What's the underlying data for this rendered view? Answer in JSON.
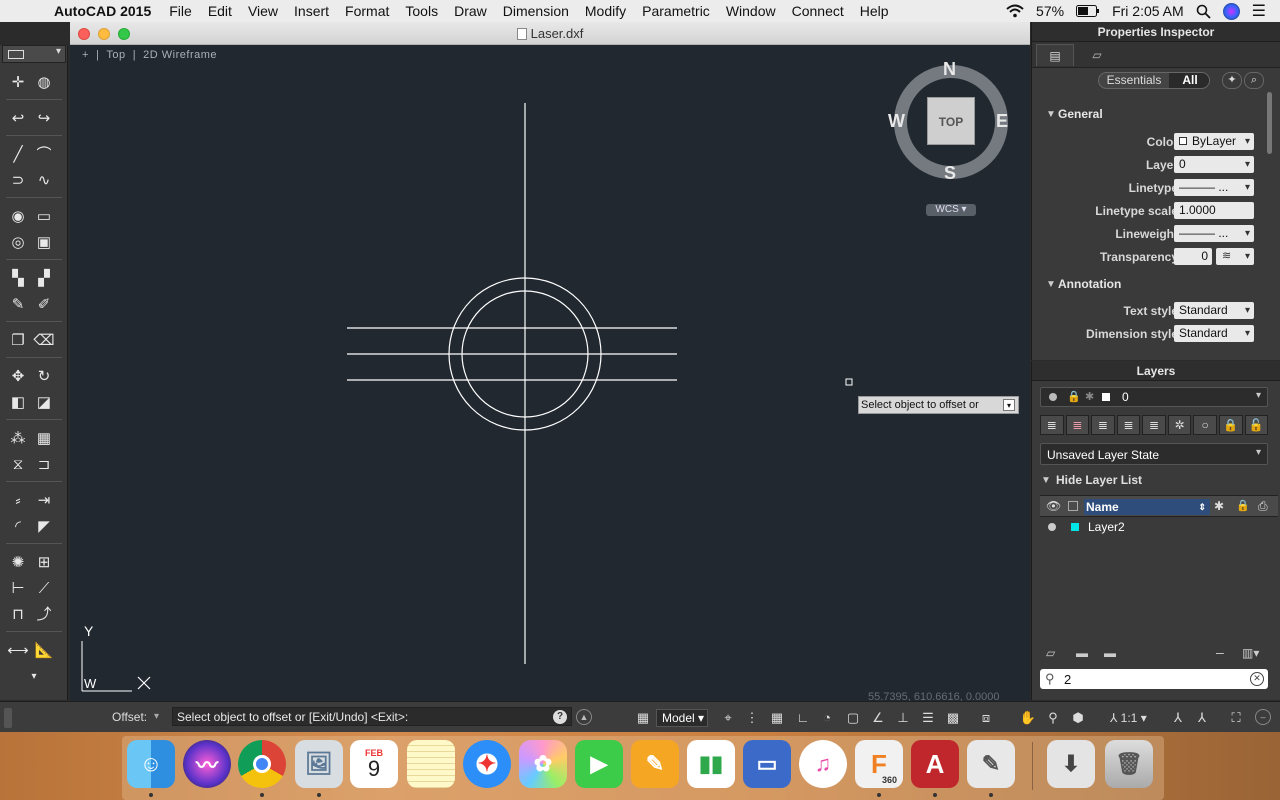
{
  "menubar": {
    "app_name": "AutoCAD 2015",
    "items": [
      "File",
      "Edit",
      "View",
      "Insert",
      "Format",
      "Tools",
      "Draw",
      "Dimension",
      "Modify",
      "Parametric",
      "Window",
      "Connect",
      "Help"
    ],
    "battery": "57%",
    "clock": "Fri 2:05 AM"
  },
  "window": {
    "title": "Laser.dxf"
  },
  "viewport": {
    "label_plus": "+",
    "view": "Top",
    "visual_style": "2D Wireframe"
  },
  "viewcube": {
    "north": "N",
    "south": "S",
    "east": "E",
    "west": "W",
    "face": "TOP",
    "ucs": "WCS"
  },
  "ucs_icon": {
    "y_label": "Y",
    "w_label": "W"
  },
  "tooltip": {
    "text": "Select object to offset or"
  },
  "coordinates": "55.7395, 610.6616, 0.0000",
  "properties": {
    "title": "Properties Inspector",
    "tabs": {
      "essentials": "Essentials",
      "all": "All"
    },
    "general_section": "General",
    "annotation_section": "Annotation",
    "rows": [
      {
        "label": "Color",
        "value": "ByLayer"
      },
      {
        "label": "Layer",
        "value": "0"
      },
      {
        "label": "Linetype",
        "value": "——— ..."
      },
      {
        "label": "Linetype scale",
        "value": "1.0000"
      },
      {
        "label": "Lineweight",
        "value": "——— ..."
      },
      {
        "label": "Transparency",
        "value": "0"
      }
    ],
    "annotation_rows": [
      {
        "label": "Text style",
        "value": "Standard"
      },
      {
        "label": "Dimension style",
        "value": "Standard"
      }
    ]
  },
  "layers": {
    "title": "Layers",
    "current_layer": "0",
    "layer_state": "Unsaved Layer State",
    "hide_list": "Hide Layer List",
    "column_name": "Name",
    "items": [
      {
        "name": "Layer2",
        "color": "#00e5e5"
      }
    ],
    "search_value": "2"
  },
  "command": {
    "prompt_label": "Offset:",
    "text": "Select object to offset or [Exit/Undo] <Exit>:"
  },
  "statusbar": {
    "model": "Model",
    "scale": "1:1"
  },
  "dock": {
    "calendar_month": "FEB",
    "calendar_day": "9",
    "fusion_label": "360",
    "apps": [
      "Finder",
      "Siri",
      "Chrome",
      "Preview",
      "Calendar",
      "Notes",
      "Safari",
      "Photos",
      "FaceTime",
      "Pages",
      "Numbers",
      "Keynote",
      "iTunes",
      "Fusion 360",
      "AutoCAD",
      "TextEdit",
      "Downloads",
      "Trash"
    ]
  }
}
